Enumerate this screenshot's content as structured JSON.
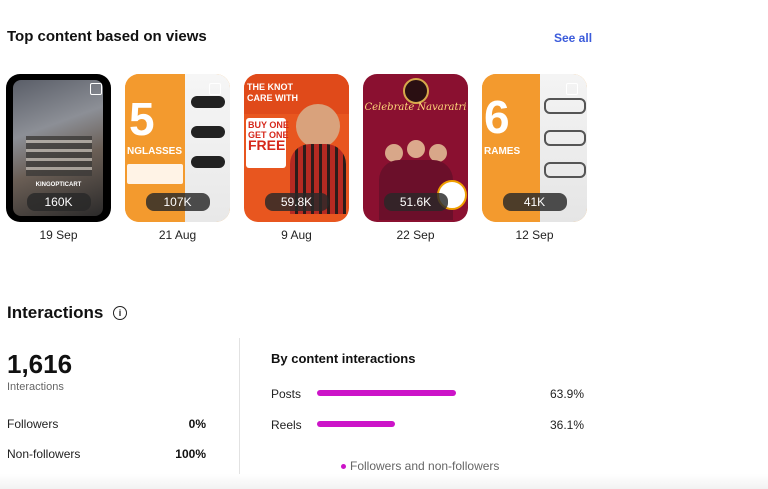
{
  "top_content": {
    "title": "Top content based on views",
    "see_all": "See all",
    "items": [
      {
        "views": "160K",
        "date": "19 Sep",
        "caption": "KINGOPTICART"
      },
      {
        "views": "107K",
        "date": "21 Aug",
        "caption": "5 NGLASSES"
      },
      {
        "views": "59.8K",
        "date": "9 Aug",
        "caption": "BUY ONE GET ONE FREE"
      },
      {
        "views": "51.6K",
        "date": "22 Sep",
        "caption": "Celebrate Navaratri"
      },
      {
        "views": "41K",
        "date": "12 Sep",
        "caption": "6 RAMES"
      }
    ]
  },
  "interactions": {
    "title": "Interactions",
    "total": "1,616",
    "total_label": "Interactions",
    "rows": [
      {
        "label": "Followers",
        "value": "0%"
      },
      {
        "label": "Non-followers",
        "value": "100%"
      }
    ],
    "by_content": {
      "title": "By content interactions",
      "items": [
        {
          "label": "Posts",
          "value": "63.9%",
          "share": 0.639
        },
        {
          "label": "Reels",
          "value": "36.1%",
          "share": 0.361
        }
      ],
      "legend": "Followers and non-followers",
      "bar_color": "#cc14c8"
    }
  }
}
